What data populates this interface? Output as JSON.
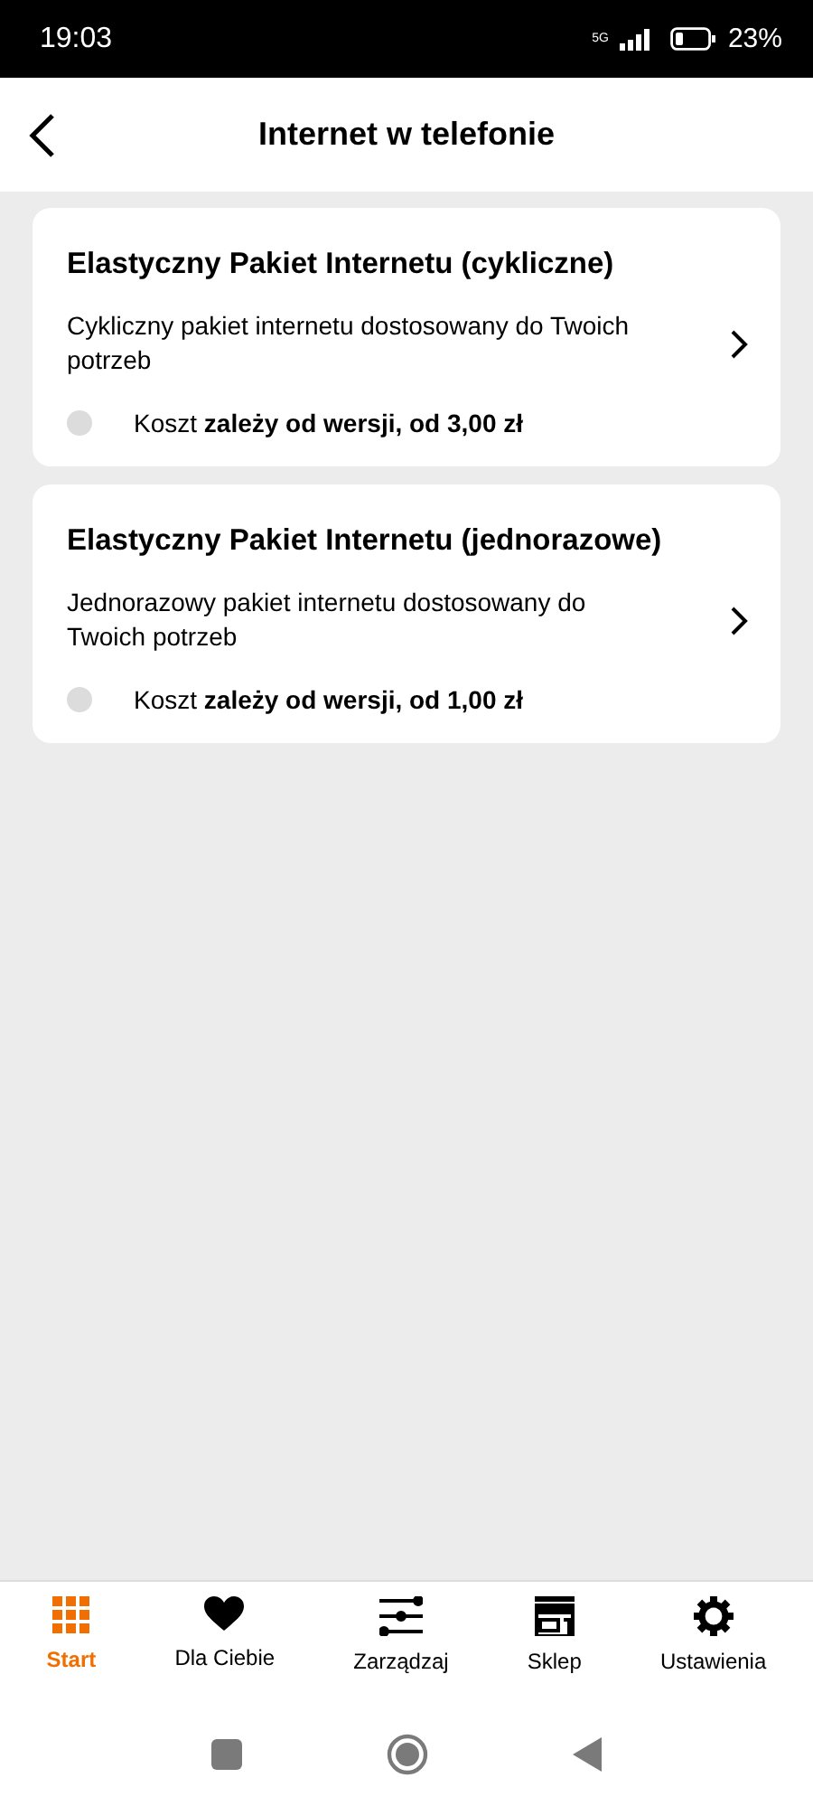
{
  "status_bar": {
    "time": "19:03",
    "network": "5G",
    "battery": "23%"
  },
  "header": {
    "title": "Internet w telefonie"
  },
  "offers": [
    {
      "title": "Elastyczny Pakiet Internetu (cykliczne)",
      "description": "Cykliczny pakiet internetu dostosowany do Twoich potrzeb",
      "cost": "Koszt **zależy od wersji, od 3,00 zł**"
    },
    {
      "title": "Elastyczny Pakiet Internetu (jednorazowe)",
      "description": "Jednorazowy pakiet internetu dostosowany do Twoich potrzeb",
      "cost": "Koszt **zależy od wersji, od 1,00 zł**"
    }
  ],
  "bottom_nav": [
    {
      "label": "Start",
      "kind": "grid",
      "selected": true
    },
    {
      "label": "Dla Ciebie",
      "kind": "heart",
      "selected": false
    },
    {
      "label": "Zarządzaj",
      "kind": "sliders",
      "selected": false
    },
    {
      "label": "Sklep",
      "kind": "shop",
      "selected": false
    },
    {
      "label": "Ustawienia",
      "kind": "gear",
      "selected": false
    }
  ]
}
